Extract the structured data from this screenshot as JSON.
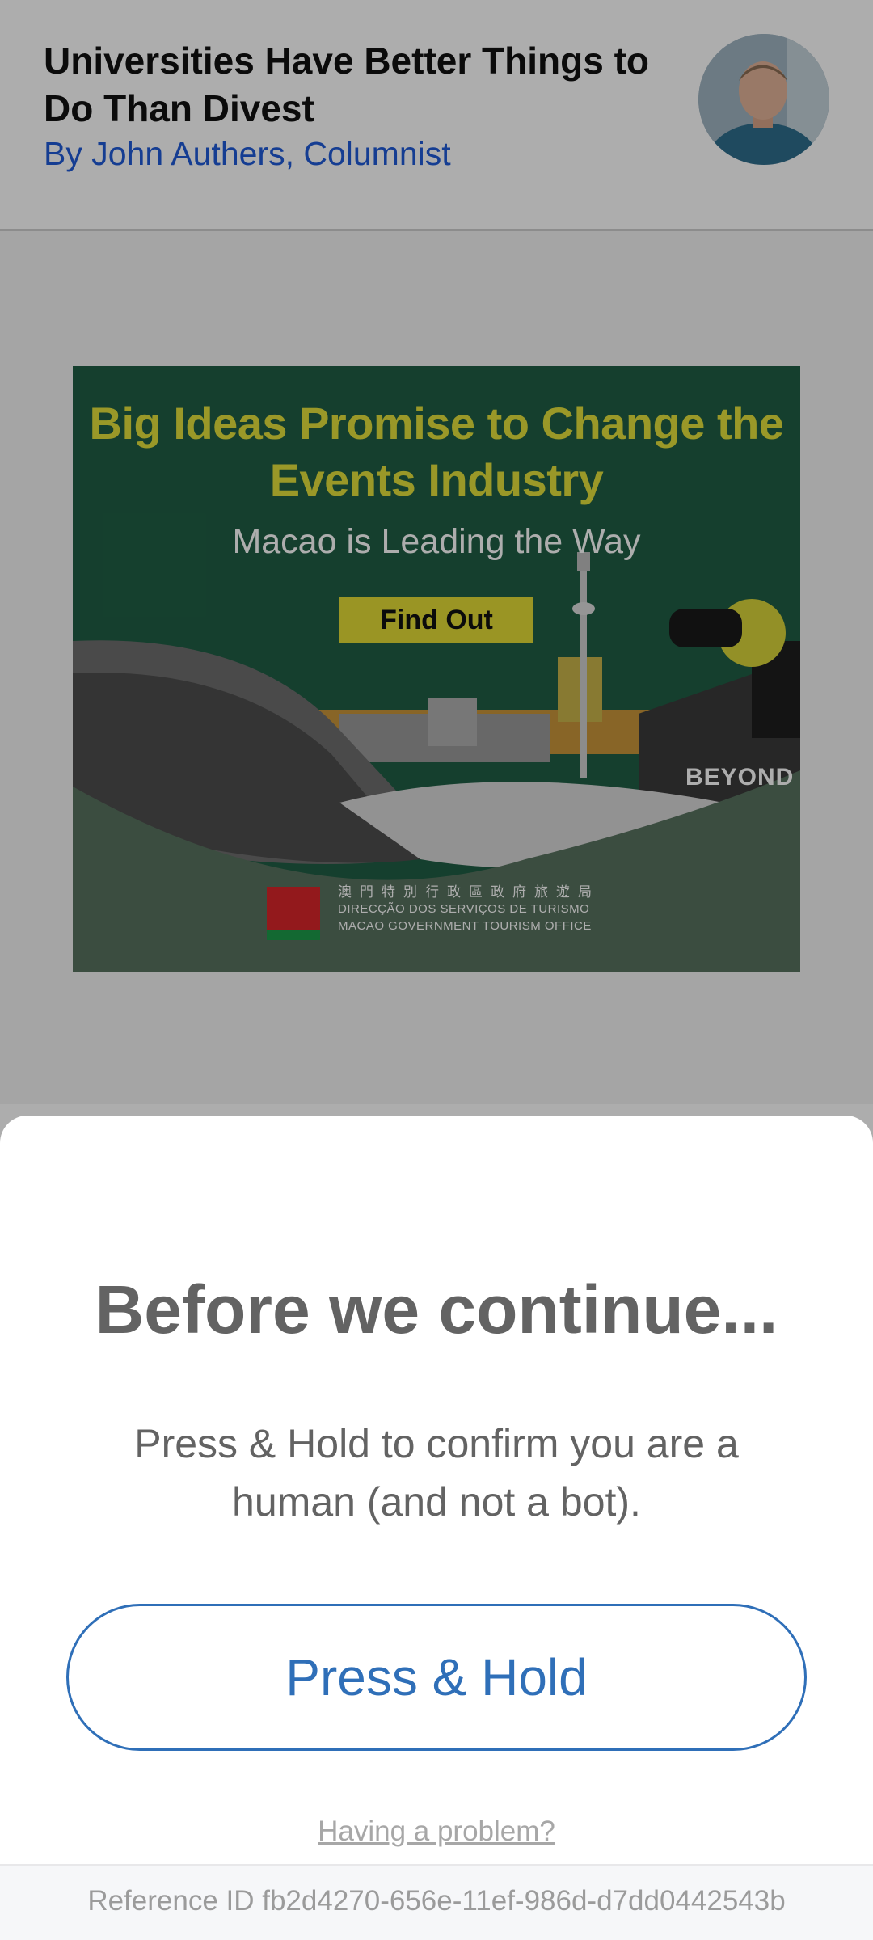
{
  "article": {
    "title": "Universities Have Better Things to Do Than Divest",
    "byline": "By John Authers, Columnist"
  },
  "ad": {
    "headline": "Big Ideas Promise to Change the Events Industry",
    "subline": "Macao is Leading the Way",
    "cta_label": "Find Out",
    "brand": "BEYOND",
    "org_name_zh": "澳門特別行政區政府旅遊局",
    "org_name_pt": "DIRECÇÃO DOS SERVIÇOS DE TURISMO",
    "org_name_en": "MACAO GOVERNMENT TOURISM OFFICE",
    "headline_color": "#e3e13c",
    "background_color": "#1f5e44"
  },
  "modal": {
    "title": "Before we continue...",
    "message": "Press & Hold to confirm you are a human (and not a bot).",
    "button_label": "Press & Hold",
    "help_link": "Having a problem?",
    "reference_id": "Reference ID fb2d4270-656e-11ef-986d-d7dd0442543b",
    "accent_color": "#2f6fb8"
  }
}
